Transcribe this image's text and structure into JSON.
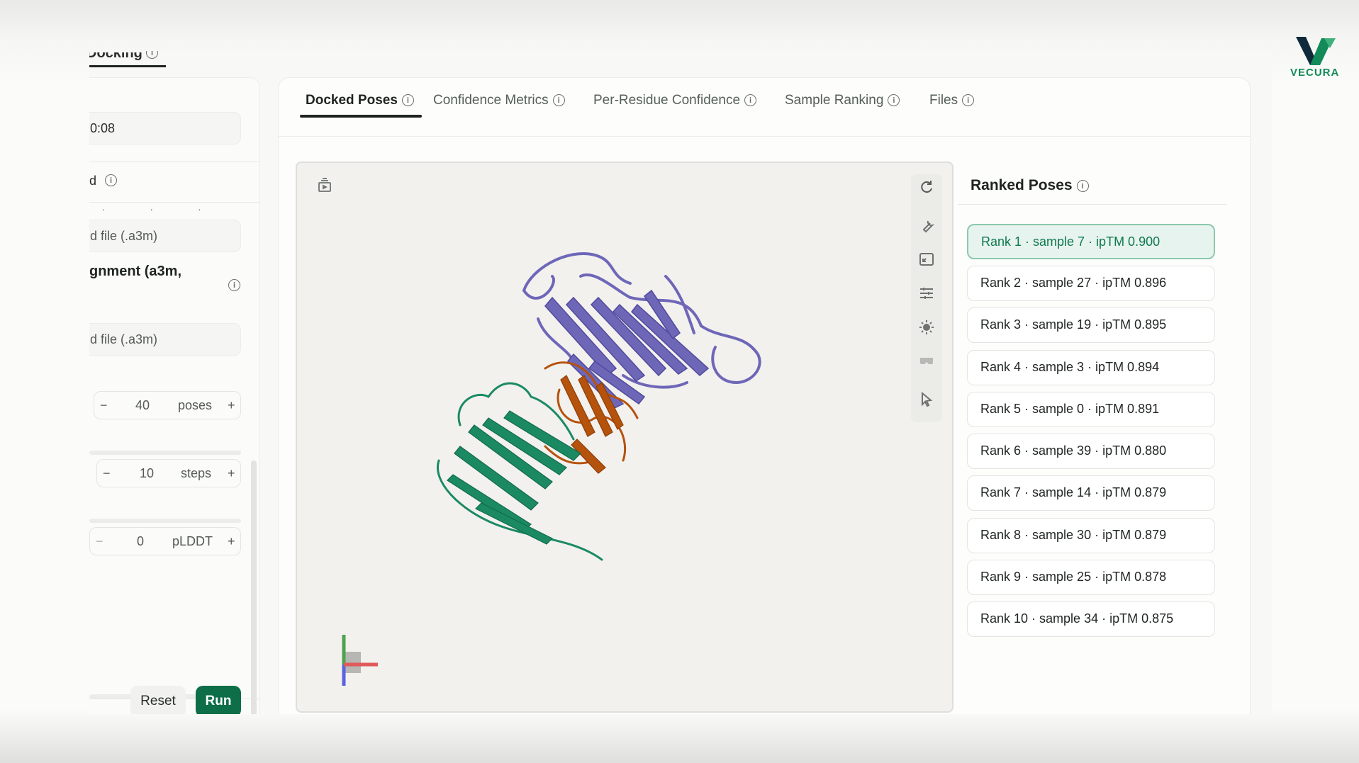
{
  "header": {
    "breadcrumb": "Docking"
  },
  "logo": {
    "text": "VECURA",
    "brand_color": "#138a5a"
  },
  "left_panel": {
    "time_value": "0:08",
    "section_label": "d",
    "msa_upload_1": "d file (.a3m)",
    "alignment_title": "gnment (a3m,",
    "msa_upload_2": "d file (.a3m)",
    "poses": {
      "value": "40",
      "unit": "poses"
    },
    "steps": {
      "value": "10",
      "unit": "steps"
    },
    "plddt": {
      "value": "0",
      "unit": "pLDDT"
    },
    "reset_label": "Reset",
    "run_label": "Run",
    "run_color": "#0d6e47"
  },
  "tabs": [
    {
      "label": "Docked Poses",
      "active": true
    },
    {
      "label": "Confidence Metrics"
    },
    {
      "label": "Per-Residue Confidence"
    },
    {
      "label": "Sample Ranking"
    },
    {
      "label": "Files"
    }
  ],
  "viewer": {
    "icons": [
      "snapshot-icon",
      "rotate-icon",
      "wrench-icon",
      "expand-icon",
      "sliders-icon",
      "light-icon",
      "vr-icon",
      "cursor-icon"
    ],
    "chain_colors": {
      "chain_a": "#6e67b8",
      "chain_b": "#b5520c",
      "chain_c": "#1b8a63"
    }
  },
  "ranked_poses": {
    "title": "Ranked Poses",
    "items": [
      {
        "label": "Rank 1 · sample 7 · ipTM 0.900",
        "selected": true
      },
      {
        "label": "Rank 2 · sample 27 · ipTM 0.896"
      },
      {
        "label": "Rank 3 · sample 19 · ipTM 0.895"
      },
      {
        "label": "Rank 4 · sample 3 · ipTM 0.894"
      },
      {
        "label": "Rank 5 · sample 0 · ipTM 0.891"
      },
      {
        "label": "Rank 6 · sample 39 · ipTM 0.880"
      },
      {
        "label": "Rank 7 · sample 14 · ipTM 0.879"
      },
      {
        "label": "Rank 8 · sample 30 · ipTM 0.879"
      },
      {
        "label": "Rank 9 · sample 25 · ipTM 0.878"
      },
      {
        "label": "Rank 10 · sample 34 · ipTM 0.875"
      }
    ]
  }
}
